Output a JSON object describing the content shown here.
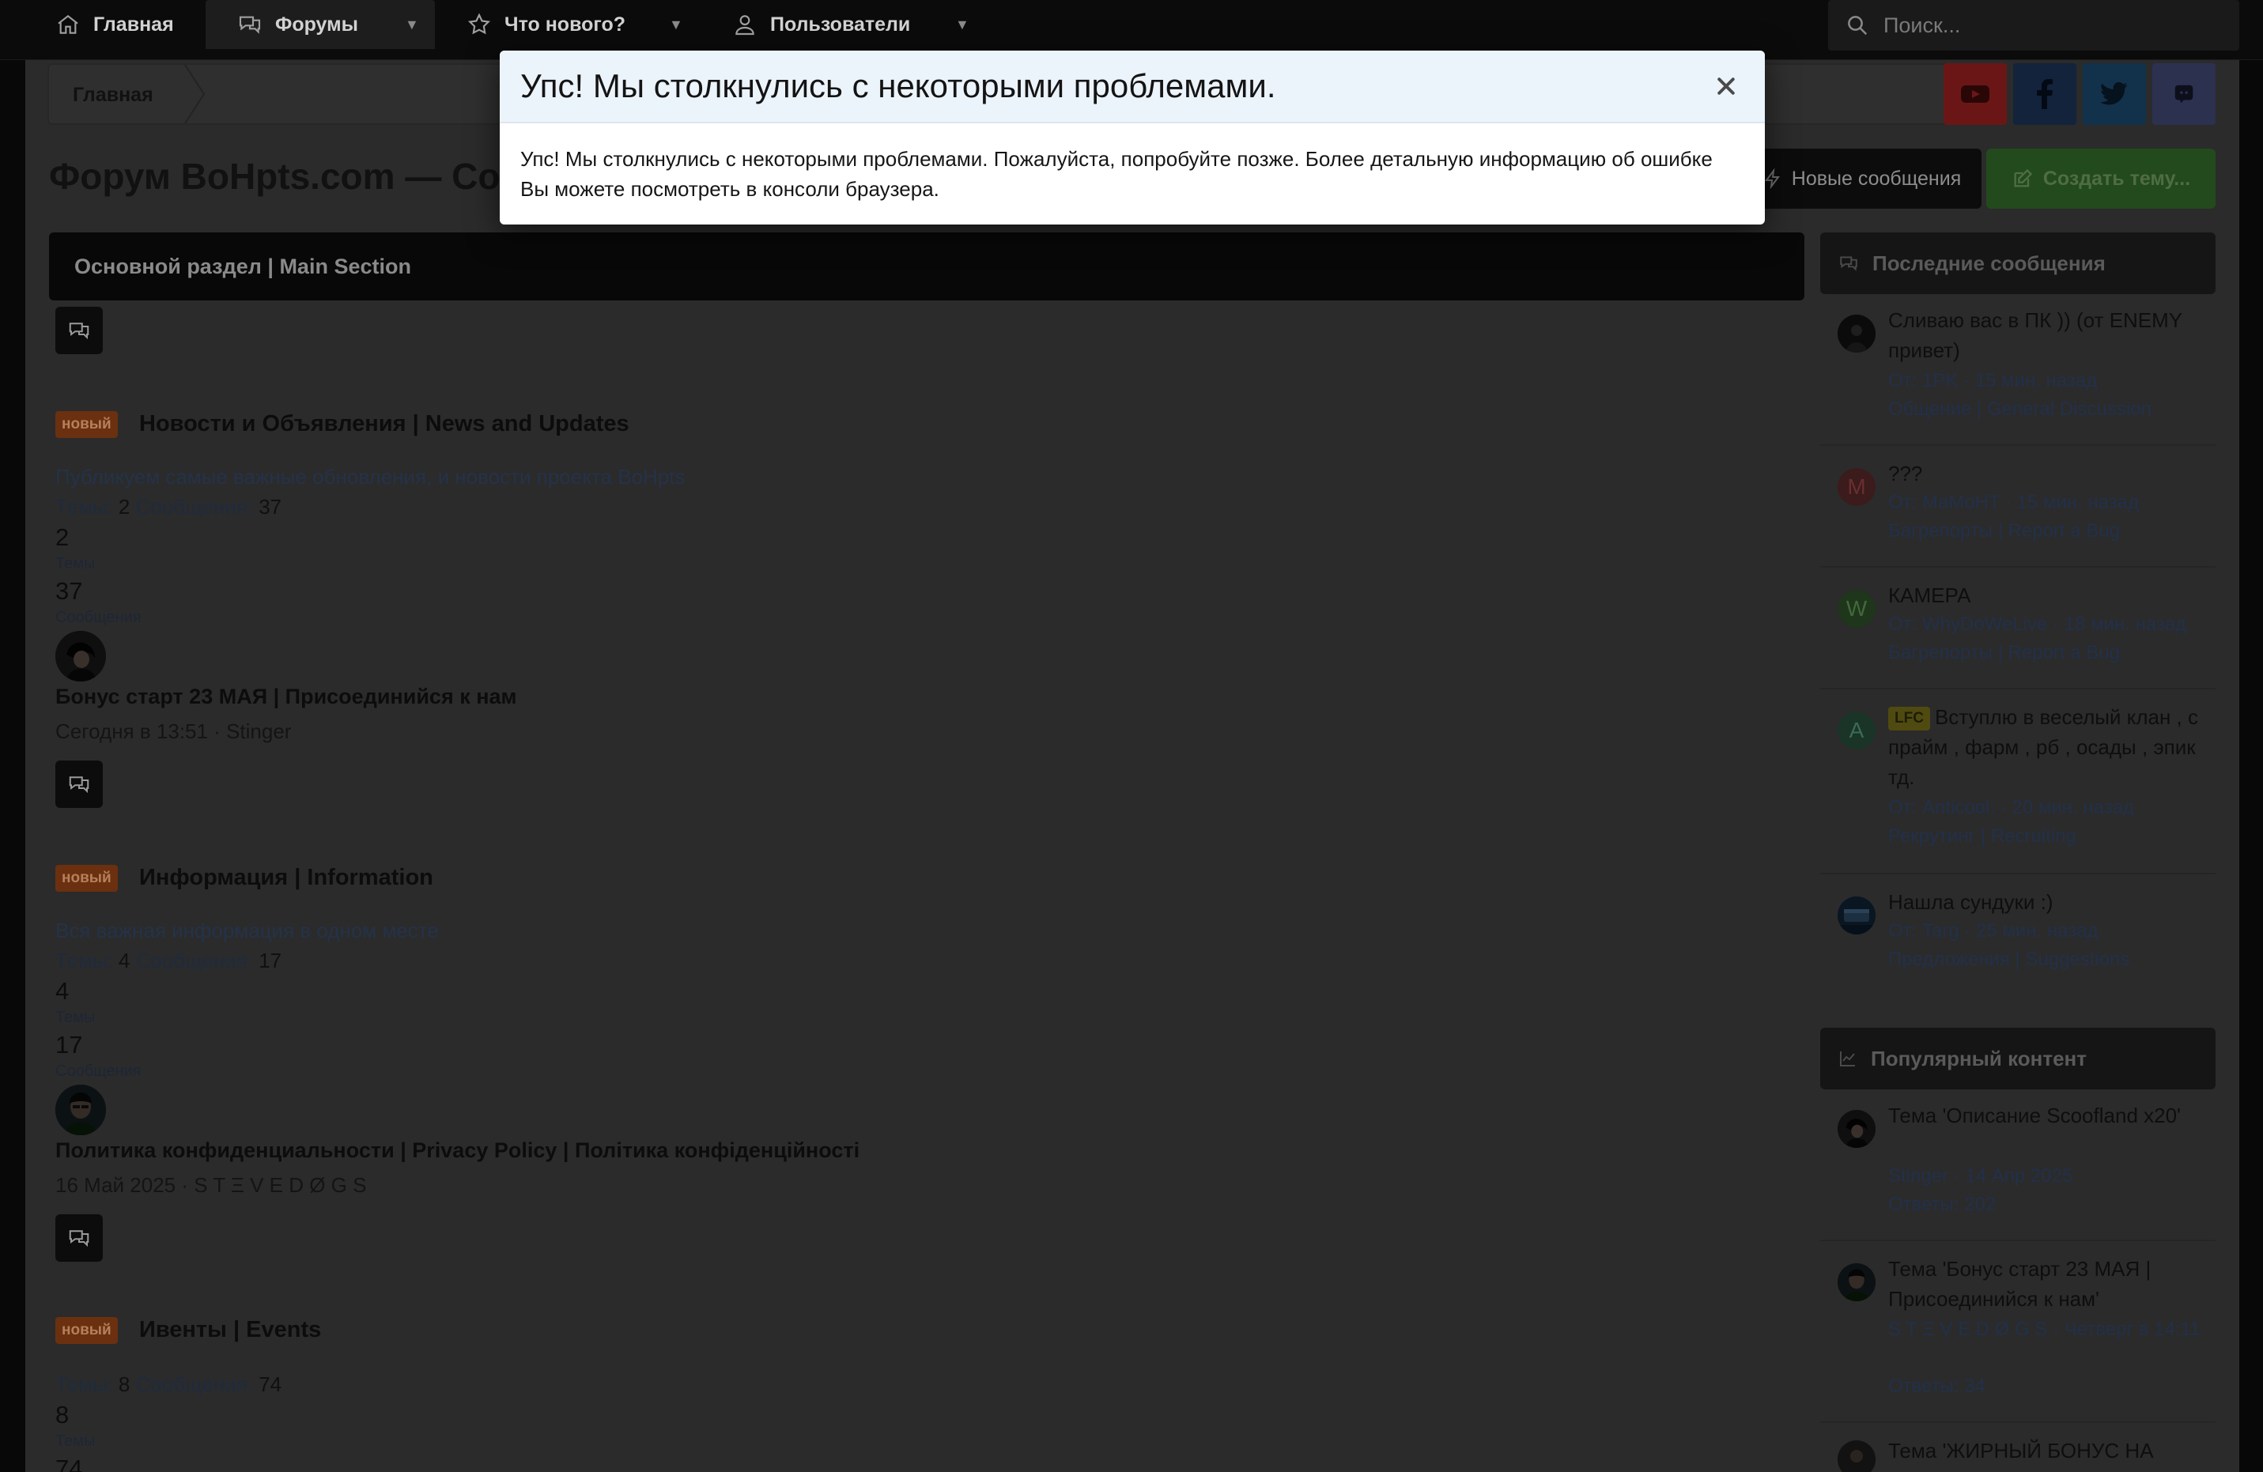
{
  "nav": {
    "items": [
      {
        "label": "Главная"
      },
      {
        "label": "Форумы"
      },
      {
        "label": "Что нового?"
      },
      {
        "label": "Пользователи"
      }
    ],
    "search_placeholder": "Поиск..."
  },
  "breadcrumb": {
    "home": "Главная"
  },
  "page_title": "Форум BoHpts.com — Сообщество",
  "buttons": {
    "new_posts": "Новые сообщения",
    "create_thread": "Создать тему..."
  },
  "section": {
    "title": "Основной раздел | Main Section"
  },
  "forums": [
    {
      "badge": "новый",
      "title": "Новости и Объявления | News and Updates",
      "description": "Публикуем самые важные обновления, и новости проекта BoHpts",
      "threads_label": "Темы:",
      "threads": "2",
      "posts_label": "Сообщения:",
      "posts": "37",
      "threads_big": "2",
      "threads_small": "Темы",
      "posts_big": "37",
      "posts_small": "Сообщения",
      "last_title": "Бонус старт 23 МАЯ | Присоединийся к нам",
      "last_meta": "Сегодня в 13:51 · Stinger"
    },
    {
      "badge": "новый",
      "title": "Информация | Information",
      "description": "Вся важная информация в одном месте",
      "threads_label": "Темы:",
      "threads": "4",
      "posts_label": "Сообщения:",
      "posts": "17",
      "threads_big": "4",
      "threads_small": "Темы",
      "posts_big": "17",
      "posts_small": "Сообщения",
      "last_title": "Политика конфиденциальности | Privacy Policy | Політика конфіденційності",
      "last_meta": "16 Май 2025 · S T Ξ V E D Ø G S"
    },
    {
      "badge": "новый",
      "title": "Ивенты | Events",
      "threads_label": "Темы:",
      "threads": "8",
      "posts_label": "Сообщения:",
      "posts": "74",
      "threads_big": "8",
      "threads_small": "Темы",
      "posts_big": "74"
    }
  ],
  "sidebar": {
    "latest_title": "Последние сообщения",
    "latest": [
      {
        "title": "Сливаю вас в ПК )) (от ENEMY привет)",
        "meta": "От: 1PK · 15 мин. назад",
        "forum": "Общение | General Discussion"
      },
      {
        "avatar_letter": "M",
        "title": "???",
        "meta": "От: MaMoHT · 15 мин. назад",
        "forum": "Багрепорты | Report a Bug"
      },
      {
        "avatar_letter": "W",
        "title": "КАМЕРА",
        "meta": "От: WhyDoWeLive · 18 мин. назад",
        "forum": "Багрепорты | Report a Bug"
      },
      {
        "avatar_letter": "A",
        "prefix": "LFC",
        "title": "Вступлю в веселый клан , с прайм , фарм , рб , осады , эпик тд.",
        "meta": "От: Anticool. · 20 мин. назад",
        "forum": "Рекрутинг | Recruiting"
      },
      {
        "title": "Нашла сундуки :)",
        "meta": "От: Targ · 25 мин. назад",
        "forum": "Предложения | Suggestions"
      }
    ],
    "popular_title": "Популярный контент",
    "popular": [
      {
        "title": "Тема 'Описание Scoofland x20'",
        "meta": "Stinger · 14 Апр 2025",
        "replies": "Ответы: 202"
      },
      {
        "title": "Тема 'Бонус старт 23 МАЯ | Присоединийся к нам'",
        "meta": "S T Ξ V E D Ø G S · Четверг в 14:11",
        "replies": "Ответы: 34"
      },
      {
        "title": "Тема 'ЖИРНЫЙ БОНУС НА"
      }
    ]
  },
  "modal": {
    "title": "Упс! Мы столкнулись с некоторыми проблемами.",
    "body": "Упс! Мы столкнулись с некоторыми проблемами. Пожалуйста, попробуйте позже. Более детальную информацию об ошибке Вы можете посмотреть в консоли браузера."
  },
  "colors": {
    "page_bg": "#2b2b2b",
    "nav_bg": "#0b0b0b",
    "badge_new": "#6b300f",
    "youtube": "#6b1616",
    "facebook": "#13233c",
    "twitter": "#12324b",
    "discord": "#2c3150",
    "modal_header": "#ecf4fb"
  }
}
